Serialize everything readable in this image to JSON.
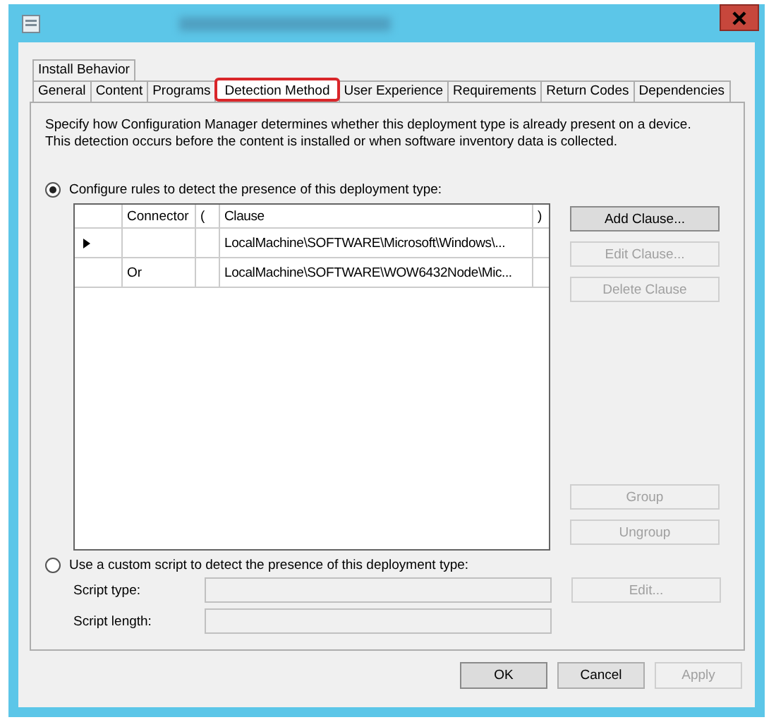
{
  "window": {
    "title_redacted": true
  },
  "tabs_upper": [
    {
      "label": "Install Behavior",
      "selected": false,
      "highlighted": false
    }
  ],
  "tabs": [
    {
      "label": "General",
      "selected": false,
      "highlighted": false
    },
    {
      "label": "Content",
      "selected": false,
      "highlighted": false
    },
    {
      "label": "Programs",
      "selected": false,
      "highlighted": false
    },
    {
      "label": "Detection Method",
      "selected": true,
      "highlighted": true
    },
    {
      "label": "User Experience",
      "selected": false,
      "highlighted": false
    },
    {
      "label": "Requirements",
      "selected": false,
      "highlighted": false
    },
    {
      "label": "Return Codes",
      "selected": false,
      "highlighted": false
    },
    {
      "label": "Dependencies",
      "selected": false,
      "highlighted": false
    }
  ],
  "description": "Specify how Configuration Manager determines whether this deployment type is already present on a device. This detection occurs before the content is installed or when software inventory data is collected.",
  "rules_option": {
    "label": "Configure rules to detect the presence of this deployment type:",
    "selected": true
  },
  "grid": {
    "columns": [
      "Connector",
      "(",
      "Clause",
      ")"
    ],
    "rows": [
      {
        "current": true,
        "cells": [
          "",
          "",
          "LocalMachine\\SOFTWARE\\Microsoft\\Windows\\...",
          ""
        ]
      },
      {
        "current": false,
        "cells": [
          "Or",
          "",
          "LocalMachine\\SOFTWARE\\WOW6432Node\\Mic...",
          ""
        ]
      }
    ]
  },
  "rule_buttons_top": [
    {
      "label": "Add Clause...",
      "disabled": false
    },
    {
      "label": "Edit Clause...",
      "disabled": true
    },
    {
      "label": "Delete Clause",
      "disabled": true
    }
  ],
  "rule_buttons_bottom": [
    {
      "label": "Group",
      "disabled": true
    },
    {
      "label": "Ungroup",
      "disabled": true
    }
  ],
  "script_option": {
    "label": "Use a custom script to detect the presence of this deployment type:",
    "selected": false
  },
  "script_fields": [
    {
      "label": "Script type:",
      "disabled": true
    },
    {
      "label": "Script length:",
      "disabled": true
    }
  ],
  "script_edit_button": {
    "label": "Edit...",
    "disabled": true
  },
  "dialog_buttons": [
    {
      "label": "OK",
      "disabled": false
    },
    {
      "label": "Cancel",
      "disabled": false
    },
    {
      "label": "Apply",
      "disabled": true
    }
  ]
}
